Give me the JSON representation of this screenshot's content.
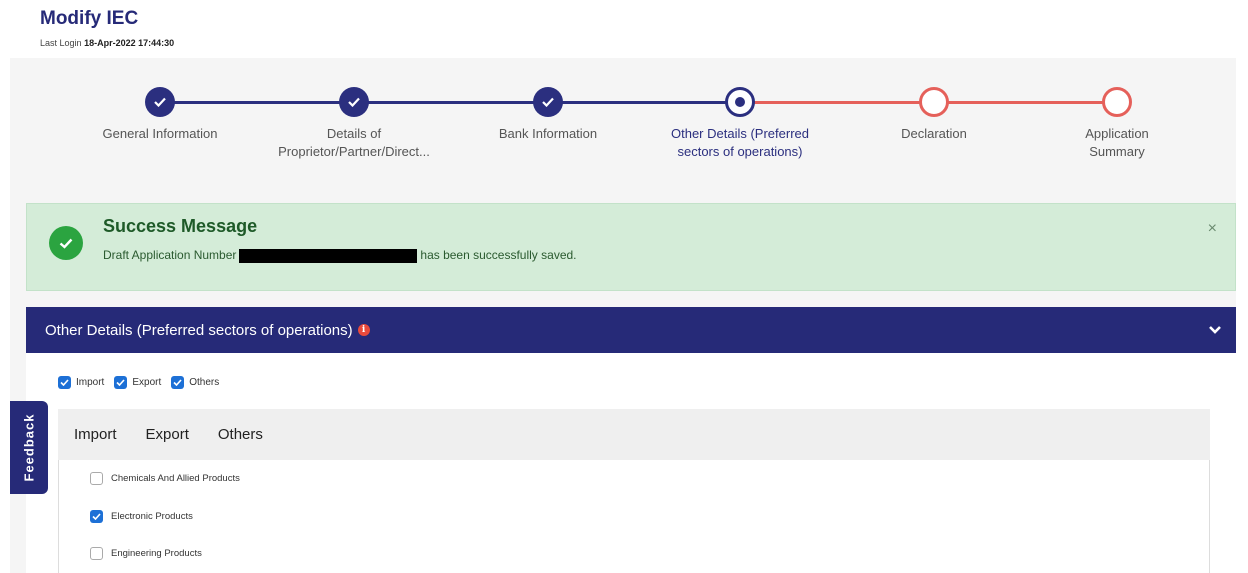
{
  "page": {
    "title": "Modify IEC",
    "last_login_label": "Last Login",
    "last_login_value": "18-Apr-2022 17:44:30"
  },
  "stepper": {
    "steps": [
      {
        "label_lines": [
          "General Information"
        ],
        "status": "done"
      },
      {
        "label_lines": [
          "Details of",
          "Proprietor/Partner/Direct..."
        ],
        "status": "done"
      },
      {
        "label_lines": [
          "Bank Information"
        ],
        "status": "done"
      },
      {
        "label_lines": [
          "Other Details (Preferred",
          "sectors of operations)"
        ],
        "status": "current"
      },
      {
        "label_lines": [
          "Declaration"
        ],
        "status": "pending"
      },
      {
        "label_lines": [
          "Application",
          "Summary"
        ],
        "status": "pending"
      }
    ],
    "colors": {
      "done": "#2b2f7f",
      "pending": "#e5605a"
    }
  },
  "alert": {
    "title": "Success Message",
    "text_before": "Draft Application Number",
    "text_after": "has been successfully saved.",
    "close": "×"
  },
  "panel": {
    "title": "Other Details (Preferred sectors of operations)",
    "info_icon": "i",
    "type_checkboxes": [
      {
        "label": "Import",
        "checked": true
      },
      {
        "label": "Export",
        "checked": true
      },
      {
        "label": "Others",
        "checked": true
      }
    ],
    "tabs": [
      "Import",
      "Export",
      "Others"
    ],
    "sectors": [
      {
        "label": "Chemicals And Allied Products",
        "checked": false
      },
      {
        "label": "Electronic Products",
        "checked": true
      },
      {
        "label": "Engineering Products",
        "checked": false
      }
    ]
  },
  "feedback": {
    "label": "Feedback"
  }
}
